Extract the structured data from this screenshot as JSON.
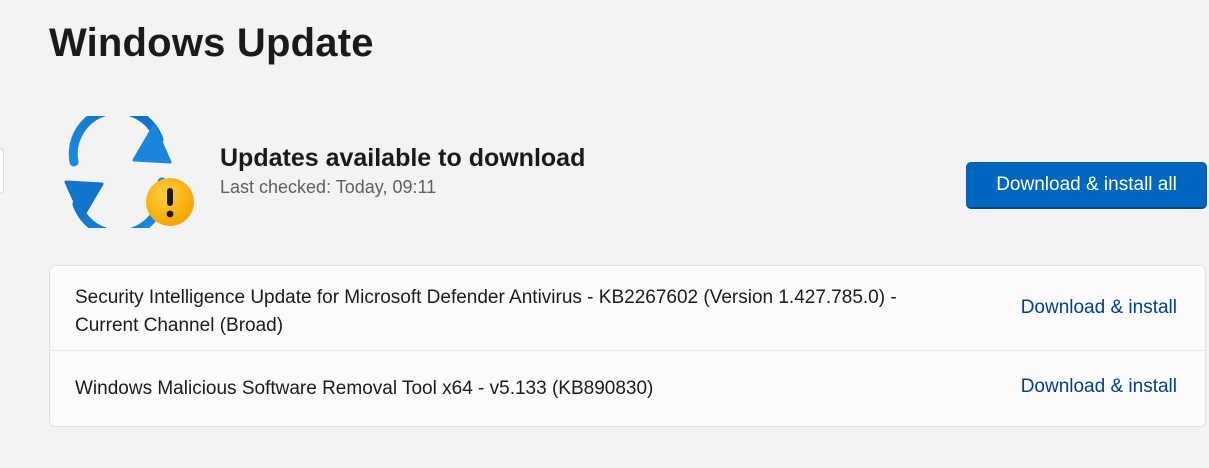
{
  "page": {
    "title": "Windows Update"
  },
  "status": {
    "icon": "sync-warning-icon",
    "title": "Updates available to download",
    "last_checked": "Last checked: Today, 09:11"
  },
  "actions": {
    "download_all_label": "Download & install all"
  },
  "updates": [
    {
      "name": "Security Intelligence Update for Microsoft Defender Antivirus - KB2267602 (Version 1.427.785.0) - Current Channel (Broad)",
      "action_label": "Download & install"
    },
    {
      "name": "Windows Malicious Software Removal Tool x64 - v5.133 (KB890830)",
      "action_label": "Download & install"
    }
  ],
  "colors": {
    "accent": "#0067c0",
    "link": "#003e92",
    "warning": "#f8a700",
    "background": "#f3f3f3"
  }
}
